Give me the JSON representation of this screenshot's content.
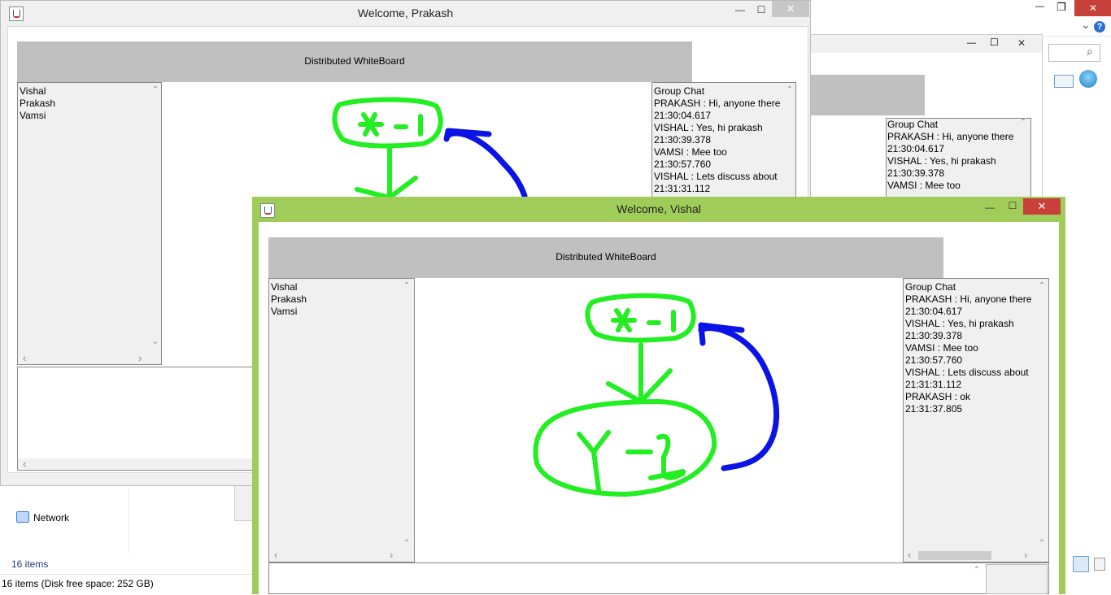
{
  "explorer": {
    "nav_network": "Network",
    "items_count": "16 items",
    "status_bar": "16 items (Disk free space: 252 GB)"
  },
  "window_back": {
    "title": "Welcome, Prakash",
    "header": "Distributed WhiteBoard",
    "users": [
      "Vishal",
      "Prakash",
      "Vamsi"
    ],
    "chat_lines": [
      "Group Chat",
      "PRAKASH : Hi, anyone there",
      "21:30:04.617",
      "VISHAL : Yes, hi prakash",
      "21:30:39.378",
      "VAMSI : Mee too",
      "21:30:57.760",
      "VISHAL : Lets discuss about",
      "21:31:31.112"
    ]
  },
  "window_mid": {
    "chat_lines": [
      "Group Chat",
      "PRAKASH : Hi, anyone there",
      "21:30:04.617",
      "VISHAL : Yes, hi prakash",
      "21:30:39.378",
      "VAMSI : Mee too"
    ]
  },
  "window_front": {
    "title": "Welcome, Vishal",
    "header": "Distributed WhiteBoard",
    "users": [
      "Vishal",
      "Prakash",
      "Vamsi"
    ],
    "chat_lines": [
      "Group Chat",
      "PRAKASH : Hi, anyone there",
      "21:30:04.617",
      "VISHAL : Yes, hi prakash",
      "21:30:39.378",
      "VAMSI : Mee too",
      "21:30:57.760",
      "VISHAL : Lets discuss about",
      "21:31:31.112",
      "PRAKASH : ok",
      "21:31:37.805"
    ],
    "accent": "#a0cc5a"
  },
  "glyphs": {
    "minimize": "—",
    "maximize": "☐",
    "restore": "❐",
    "close": "✕",
    "up": "⌃",
    "down": "⌄",
    "left": "‹",
    "right": "›",
    "search": "⌕",
    "help": "?",
    "chevron": "⌄"
  },
  "colors": {
    "green_ink": "#22ee22",
    "blue_ink": "#0a14e6",
    "close_red": "#c7403a"
  }
}
